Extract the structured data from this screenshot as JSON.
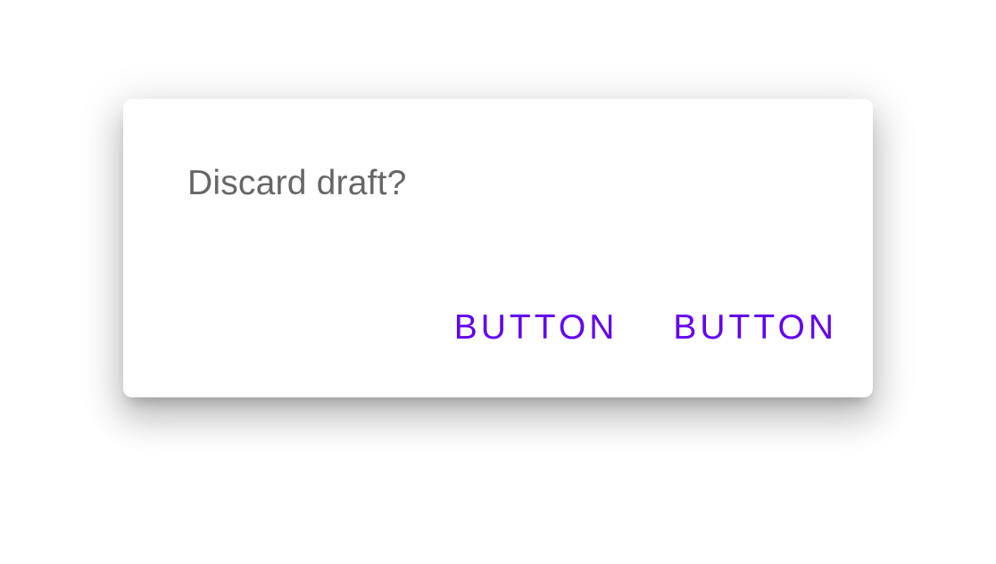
{
  "dialog": {
    "message": "Discard draft?",
    "actions": [
      {
        "label": "BUTTON"
      },
      {
        "label": "BUTTON"
      }
    ]
  },
  "colors": {
    "accent": "#6200ee",
    "message_text": "#666666",
    "surface": "#ffffff"
  }
}
